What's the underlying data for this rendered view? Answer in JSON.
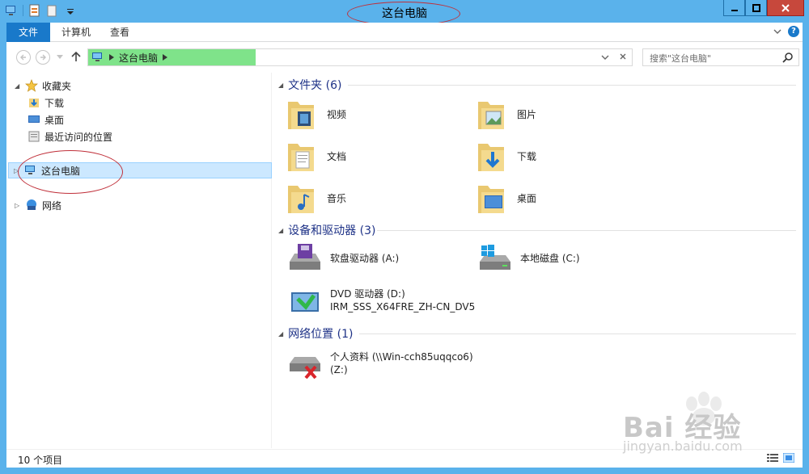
{
  "window": {
    "title": "这台电脑"
  },
  "ribbon": {
    "tabs": [
      {
        "label": "文件"
      },
      {
        "label": "计算机"
      },
      {
        "label": "查看"
      }
    ],
    "help_label": "?"
  },
  "address": {
    "crumb": "这台电脑",
    "search_placeholder": "搜索\"这台电脑\""
  },
  "nav": {
    "favorites": "收藏夹",
    "downloads": "下载",
    "desktop": "桌面",
    "recent": "最近访问的位置",
    "this_pc": "这台电脑",
    "network": "网络"
  },
  "content": {
    "folders_header": "文件夹 (6)",
    "folders": [
      {
        "label": "视频",
        "icon": "videos-folder-icon"
      },
      {
        "label": "图片",
        "icon": "pictures-folder-icon"
      },
      {
        "label": "文档",
        "icon": "documents-folder-icon"
      },
      {
        "label": "下载",
        "icon": "downloads-folder-icon"
      },
      {
        "label": "音乐",
        "icon": "music-folder-icon"
      },
      {
        "label": "桌面",
        "icon": "desktop-folder-icon"
      }
    ],
    "devices_header": "设备和驱动器 (3)",
    "devices": [
      {
        "label": "软盘驱动器 (A:)",
        "icon": "floppy-drive-icon"
      },
      {
        "label": "本地磁盘 (C:)",
        "icon": "local-disk-icon"
      },
      {
        "label1": "DVD 驱动器 (D:)",
        "label2": "IRM_SSS_X64FRE_ZH-CN_DV5",
        "icon": "dvd-drive-icon"
      }
    ],
    "network_header": "网络位置 (1)",
    "network_items": [
      {
        "label1": "个人资料 (\\\\Win-cch85uqqco6)",
        "label2": "(Z:)",
        "icon": "network-drive-disconnected-icon"
      }
    ]
  },
  "status": {
    "item_count": "10 个项目"
  },
  "watermark": {
    "text": "Bai 经验",
    "sub": "jingyan.baidu.com"
  },
  "colors": {
    "titlebar": "#5ab2eb",
    "file_tab": "#1979ca",
    "address_highlight": "#7fe38a",
    "group_title": "#1e3287",
    "selection": "#cce8ff",
    "annotation": "#c0303a"
  }
}
